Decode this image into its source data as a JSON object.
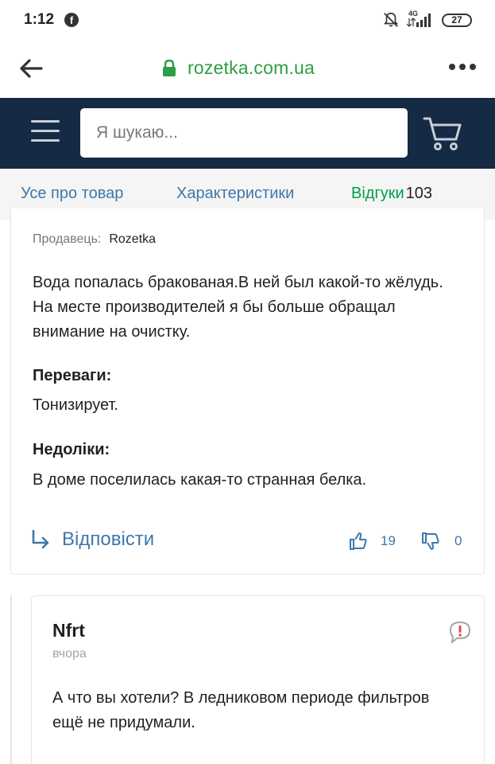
{
  "status_bar": {
    "time": "1:12",
    "facebook_icon": "facebook-icon",
    "network": "4G",
    "battery": "27"
  },
  "browser": {
    "url": "rozetka.com.ua",
    "url_color": "#2e9e45"
  },
  "header": {
    "search_placeholder": "Я шукаю...",
    "background": "#152a45"
  },
  "tabs": [
    {
      "label": "Усе про товар",
      "active": false
    },
    {
      "label": "Характеристики",
      "active": false
    },
    {
      "label": "Відгуки",
      "count": "103",
      "active": true
    }
  ],
  "review": {
    "seller_label": "Продавець:",
    "seller_name": "Rozetka",
    "text": "Вода попалась бракованая.В ней был какой-то жёлудь. На месте производителей я бы больше обращал внимание на очистку.",
    "pros_title": "Переваги:",
    "pros_text": "Тонизирует.",
    "cons_title": "Недоліки:",
    "cons_text": "В доме поселилась какая-то странная белка.",
    "reply_label": "Відповісти",
    "likes": "19",
    "dislikes": "0"
  },
  "answer": {
    "author": "Nfrt",
    "date": "вчора",
    "text": "А что вы хотели? В ледниковом периоде фильтров ещё не придумали."
  },
  "colors": {
    "accent_green": "#00a046",
    "link_blue": "#3e77aa",
    "text_dark": "#221f1f"
  }
}
